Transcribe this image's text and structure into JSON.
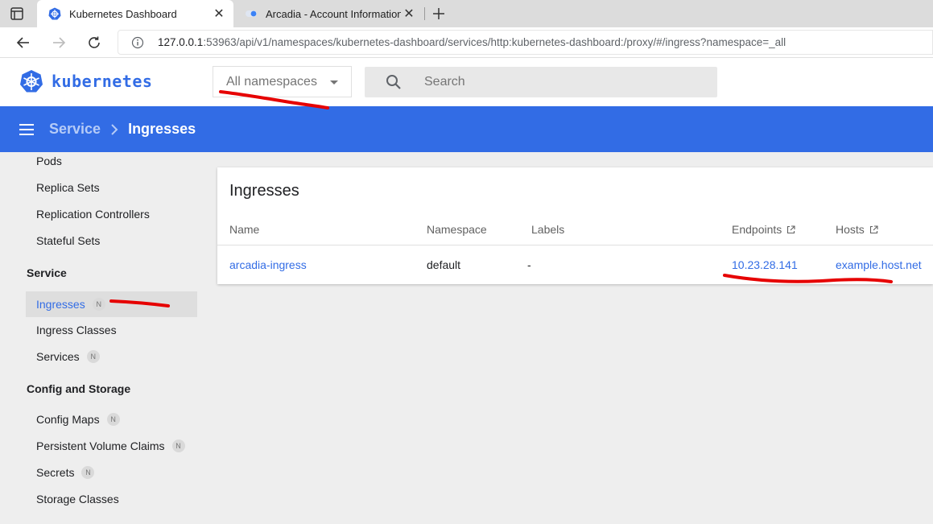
{
  "browser": {
    "tabs": [
      {
        "title": "Kubernetes Dashboard",
        "active": true,
        "close": "✕"
      },
      {
        "title": "Arcadia - Account Information",
        "active": false,
        "close": "✕"
      }
    ],
    "url_host": "127.0.0.1",
    "url_rest": ":53963/api/v1/namespaces/kubernetes-dashboard/services/http:kubernetes-dashboard:/proxy/#/ingress?namespace=_all"
  },
  "header": {
    "logo_text": "kubernetes",
    "namespace_value": "All namespaces",
    "search_placeholder": "Search"
  },
  "breadcrumb": {
    "parent": "Service",
    "current": "Ingresses"
  },
  "sidebar": {
    "workloads_items": [
      {
        "label": "Pods"
      },
      {
        "label": "Replica Sets"
      },
      {
        "label": "Replication Controllers"
      },
      {
        "label": "Stateful Sets"
      }
    ],
    "service_group": "Service",
    "service_items": [
      {
        "label": "Ingresses",
        "badge": "N",
        "selected": true
      },
      {
        "label": "Ingress Classes"
      },
      {
        "label": "Services",
        "badge": "N"
      }
    ],
    "config_group": "Config and Storage",
    "config_items": [
      {
        "label": "Config Maps",
        "badge": "N"
      },
      {
        "label": "Persistent Volume Claims",
        "badge": "N"
      },
      {
        "label": "Secrets",
        "badge": "N"
      },
      {
        "label": "Storage Classes"
      }
    ]
  },
  "card": {
    "title": "Ingresses",
    "columns": {
      "name": "Name",
      "namespace": "Namespace",
      "labels": "Labels",
      "endpoints": "Endpoints",
      "hosts": "Hosts"
    },
    "rows": [
      {
        "name": "arcadia-ingress",
        "namespace": "default",
        "labels": "-",
        "endpoints": "10.23.28.141",
        "hosts": "example.host.net"
      }
    ]
  },
  "colors": {
    "brand": "#326ce5",
    "annotation": "#e60000"
  }
}
